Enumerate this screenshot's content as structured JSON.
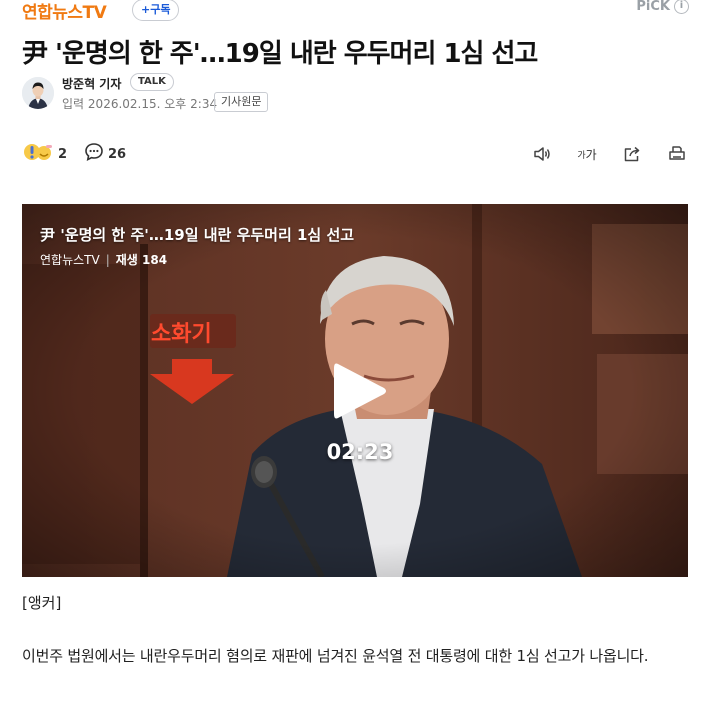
{
  "header": {
    "press_name": "연합뉴스TV",
    "subscribe_label": "+구독",
    "pick_label": "PiCK",
    "pick_info_icon": "i"
  },
  "article": {
    "headline": "尹 '운명의 한 주'…19일 내란 우두머리 1심 선고",
    "reporter": "방준혁 기자",
    "talk_label": "TALK",
    "date_label": "입력",
    "date": "2026.02.15. 오후 2:34",
    "origin_label": "기사원문"
  },
  "actions": {
    "reaction_icon": "reaction-emoji-icon",
    "reaction_count": "2",
    "comment_icon": "comment-icon",
    "comment_count": "26",
    "font_label_small": "가",
    "font_label_large": "가"
  },
  "video": {
    "title": "尹 '운명의 한 주'…19일 내란 우두머리 1심 선고",
    "channel": "연합뉴스TV",
    "plays": "재생 184",
    "duration": "02:23",
    "sign_text": "소화기"
  },
  "body": {
    "anchor": "[앵커]",
    "paragraph": "이번주 법원에서는 내란우두머리 혐의로 재판에 넘겨진 윤석열 전 대통령에 대한 1심 선고가 나옵니다."
  },
  "colors": {
    "press_orange": "#f07a12",
    "subscribe_blue": "#1a5ad8",
    "muted_gray": "#9aa0a6"
  }
}
